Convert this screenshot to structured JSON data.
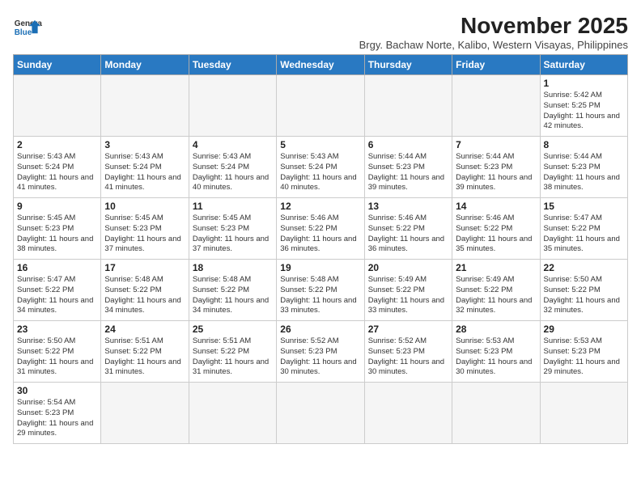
{
  "header": {
    "logo_general": "General",
    "logo_blue": "Blue",
    "month_title": "November 2025",
    "location": "Brgy. Bachaw Norte, Kalibo, Western Visayas, Philippines"
  },
  "days_of_week": [
    "Sunday",
    "Monday",
    "Tuesday",
    "Wednesday",
    "Thursday",
    "Friday",
    "Saturday"
  ],
  "weeks": [
    [
      {
        "day": "",
        "info": ""
      },
      {
        "day": "",
        "info": ""
      },
      {
        "day": "",
        "info": ""
      },
      {
        "day": "",
        "info": ""
      },
      {
        "day": "",
        "info": ""
      },
      {
        "day": "",
        "info": ""
      },
      {
        "day": "1",
        "info": "Sunrise: 5:42 AM\nSunset: 5:25 PM\nDaylight: 11 hours and 42 minutes."
      }
    ],
    [
      {
        "day": "2",
        "info": "Sunrise: 5:43 AM\nSunset: 5:24 PM\nDaylight: 11 hours and 41 minutes."
      },
      {
        "day": "3",
        "info": "Sunrise: 5:43 AM\nSunset: 5:24 PM\nDaylight: 11 hours and 41 minutes."
      },
      {
        "day": "4",
        "info": "Sunrise: 5:43 AM\nSunset: 5:24 PM\nDaylight: 11 hours and 40 minutes."
      },
      {
        "day": "5",
        "info": "Sunrise: 5:43 AM\nSunset: 5:24 PM\nDaylight: 11 hours and 40 minutes."
      },
      {
        "day": "6",
        "info": "Sunrise: 5:44 AM\nSunset: 5:23 PM\nDaylight: 11 hours and 39 minutes."
      },
      {
        "day": "7",
        "info": "Sunrise: 5:44 AM\nSunset: 5:23 PM\nDaylight: 11 hours and 39 minutes."
      },
      {
        "day": "8",
        "info": "Sunrise: 5:44 AM\nSunset: 5:23 PM\nDaylight: 11 hours and 38 minutes."
      }
    ],
    [
      {
        "day": "9",
        "info": "Sunrise: 5:45 AM\nSunset: 5:23 PM\nDaylight: 11 hours and 38 minutes."
      },
      {
        "day": "10",
        "info": "Sunrise: 5:45 AM\nSunset: 5:23 PM\nDaylight: 11 hours and 37 minutes."
      },
      {
        "day": "11",
        "info": "Sunrise: 5:45 AM\nSunset: 5:23 PM\nDaylight: 11 hours and 37 minutes."
      },
      {
        "day": "12",
        "info": "Sunrise: 5:46 AM\nSunset: 5:22 PM\nDaylight: 11 hours and 36 minutes."
      },
      {
        "day": "13",
        "info": "Sunrise: 5:46 AM\nSunset: 5:22 PM\nDaylight: 11 hours and 36 minutes."
      },
      {
        "day": "14",
        "info": "Sunrise: 5:46 AM\nSunset: 5:22 PM\nDaylight: 11 hours and 35 minutes."
      },
      {
        "day": "15",
        "info": "Sunrise: 5:47 AM\nSunset: 5:22 PM\nDaylight: 11 hours and 35 minutes."
      }
    ],
    [
      {
        "day": "16",
        "info": "Sunrise: 5:47 AM\nSunset: 5:22 PM\nDaylight: 11 hours and 34 minutes."
      },
      {
        "day": "17",
        "info": "Sunrise: 5:48 AM\nSunset: 5:22 PM\nDaylight: 11 hours and 34 minutes."
      },
      {
        "day": "18",
        "info": "Sunrise: 5:48 AM\nSunset: 5:22 PM\nDaylight: 11 hours and 34 minutes."
      },
      {
        "day": "19",
        "info": "Sunrise: 5:48 AM\nSunset: 5:22 PM\nDaylight: 11 hours and 33 minutes."
      },
      {
        "day": "20",
        "info": "Sunrise: 5:49 AM\nSunset: 5:22 PM\nDaylight: 11 hours and 33 minutes."
      },
      {
        "day": "21",
        "info": "Sunrise: 5:49 AM\nSunset: 5:22 PM\nDaylight: 11 hours and 32 minutes."
      },
      {
        "day": "22",
        "info": "Sunrise: 5:50 AM\nSunset: 5:22 PM\nDaylight: 11 hours and 32 minutes."
      }
    ],
    [
      {
        "day": "23",
        "info": "Sunrise: 5:50 AM\nSunset: 5:22 PM\nDaylight: 11 hours and 31 minutes."
      },
      {
        "day": "24",
        "info": "Sunrise: 5:51 AM\nSunset: 5:22 PM\nDaylight: 11 hours and 31 minutes."
      },
      {
        "day": "25",
        "info": "Sunrise: 5:51 AM\nSunset: 5:22 PM\nDaylight: 11 hours and 31 minutes."
      },
      {
        "day": "26",
        "info": "Sunrise: 5:52 AM\nSunset: 5:23 PM\nDaylight: 11 hours and 30 minutes."
      },
      {
        "day": "27",
        "info": "Sunrise: 5:52 AM\nSunset: 5:23 PM\nDaylight: 11 hours and 30 minutes."
      },
      {
        "day": "28",
        "info": "Sunrise: 5:53 AM\nSunset: 5:23 PM\nDaylight: 11 hours and 30 minutes."
      },
      {
        "day": "29",
        "info": "Sunrise: 5:53 AM\nSunset: 5:23 PM\nDaylight: 11 hours and 29 minutes."
      }
    ],
    [
      {
        "day": "30",
        "info": "Sunrise: 5:54 AM\nSunset: 5:23 PM\nDaylight: 11 hours and 29 minutes."
      },
      {
        "day": "",
        "info": ""
      },
      {
        "day": "",
        "info": ""
      },
      {
        "day": "",
        "info": ""
      },
      {
        "day": "",
        "info": ""
      },
      {
        "day": "",
        "info": ""
      },
      {
        "day": "",
        "info": ""
      }
    ]
  ]
}
